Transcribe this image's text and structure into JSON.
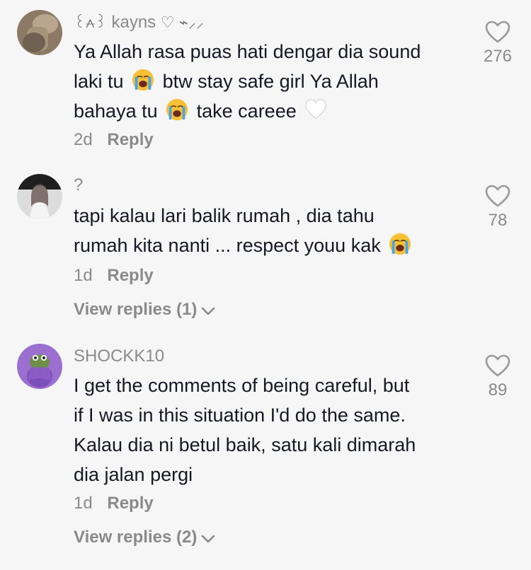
{
  "comments": [
    {
      "username": "kayns",
      "username_prefix": "꒰⩜꒱",
      "username_suffix": "♡ ⌁⸝⸝",
      "lines": [
        [
          "Ya Allah rasa puas hati dengar dia sound"
        ],
        [
          "laki tu",
          "😭",
          "btw stay safe girl Ya Allah"
        ],
        [
          "bahaya tu",
          "😭",
          "take careee",
          "🤍"
        ]
      ],
      "time": "2d",
      "reply_label": "Reply",
      "likes": "276"
    },
    {
      "username": "?",
      "lines": [
        [
          "tapi kalau lari balik rumah , dia tahu"
        ],
        [
          "rumah kita nanti ... respect youu kak",
          "😭"
        ]
      ],
      "time": "1d",
      "reply_label": "Reply",
      "likes": "78",
      "view_replies": "View replies (1)"
    },
    {
      "username": "SHOCKK10",
      "lines": [
        [
          "I get the comments of being careful, but"
        ],
        [
          "if I was in this situation I'd do the same."
        ],
        [
          "Kalau dia ni betul baik, satu kali dimarah"
        ],
        [
          "dia jalan pergi"
        ]
      ],
      "time": "1d",
      "reply_label": "Reply",
      "likes": "89",
      "view_replies": "View replies (2)"
    }
  ],
  "colors": {
    "background": "#f6f6f6",
    "text": "#161823",
    "muted": "#8a8a8a"
  },
  "icons": {
    "like": "heart-outline-icon",
    "expand": "chevron-down-icon",
    "emoji_cry": "loudly-crying-face-emoji",
    "emoji_heart": "white-heart-emoji"
  }
}
